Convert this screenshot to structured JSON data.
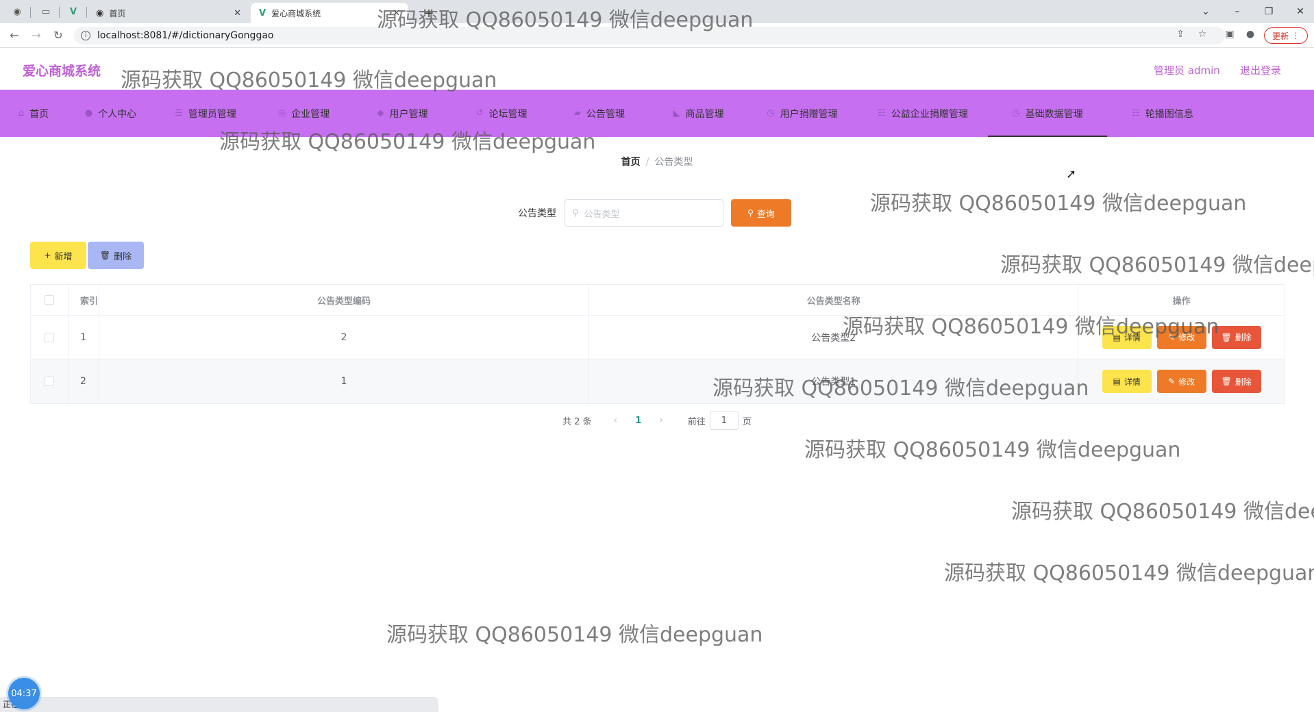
{
  "browser": {
    "tabs": [
      {
        "title": "首页"
      },
      {
        "title": "爱心商城系统"
      }
    ],
    "new_tab_label": "+",
    "url": "localhost:8081/#/dictionaryGonggao",
    "update_label": "更新"
  },
  "header": {
    "logo": "爱心商城系统",
    "user": "管理员 admin",
    "logout": "退出登录"
  },
  "nav": {
    "items": [
      {
        "label": "首页",
        "icon": "home-icon"
      },
      {
        "label": "个人中心",
        "icon": "user-icon"
      },
      {
        "label": "管理员管理",
        "icon": "menu-icon"
      },
      {
        "label": "企业管理",
        "icon": "globe-icon"
      },
      {
        "label": "用户管理",
        "icon": "chat-icon"
      },
      {
        "label": "论坛管理",
        "icon": "refresh-icon"
      },
      {
        "label": "公告管理",
        "icon": "briefcase-icon"
      },
      {
        "label": "商品管理",
        "icon": "tag-icon"
      },
      {
        "label": "用户捐赠管理",
        "icon": "clock-icon"
      },
      {
        "label": "公益企业捐赠管理",
        "icon": "list-icon"
      },
      {
        "label": "基础数据管理",
        "icon": "clock-icon"
      },
      {
        "label": "轮播图信息",
        "icon": "list-icon"
      }
    ],
    "active_index": 10
  },
  "breadcrumb": {
    "home": "首页",
    "separator": "/",
    "current": "公告类型"
  },
  "search": {
    "label": "公告类型",
    "placeholder": "公告类型",
    "button": "查询"
  },
  "actions": {
    "add": "新增",
    "delete": "删除"
  },
  "table": {
    "headers": [
      "索引",
      "公告类型编码",
      "公告类型名称",
      "操作"
    ],
    "rows": [
      {
        "index": "1",
        "code": "2",
        "name": "公告类型2"
      },
      {
        "index": "2",
        "code": "1",
        "name": "公告类型1"
      }
    ],
    "row_actions": {
      "detail": "详情",
      "edit": "修改",
      "delete": "删除"
    }
  },
  "pagination": {
    "total": "共 2 条",
    "current_page": "1",
    "goto_prefix": "前往",
    "goto_value": "1",
    "goto_suffix": "页"
  },
  "watermark": "源码获取 QQ86050149 微信deepguan",
  "status_text": "正在...",
  "clock": "04:37",
  "colors": {
    "nav_bg": "#c66ff0",
    "brand": "#c05fd8",
    "search_button": "#ee7a27",
    "add_button": "#fde34c",
    "delete_button": "#a9b7f5",
    "row_delete": "#e8563a"
  }
}
